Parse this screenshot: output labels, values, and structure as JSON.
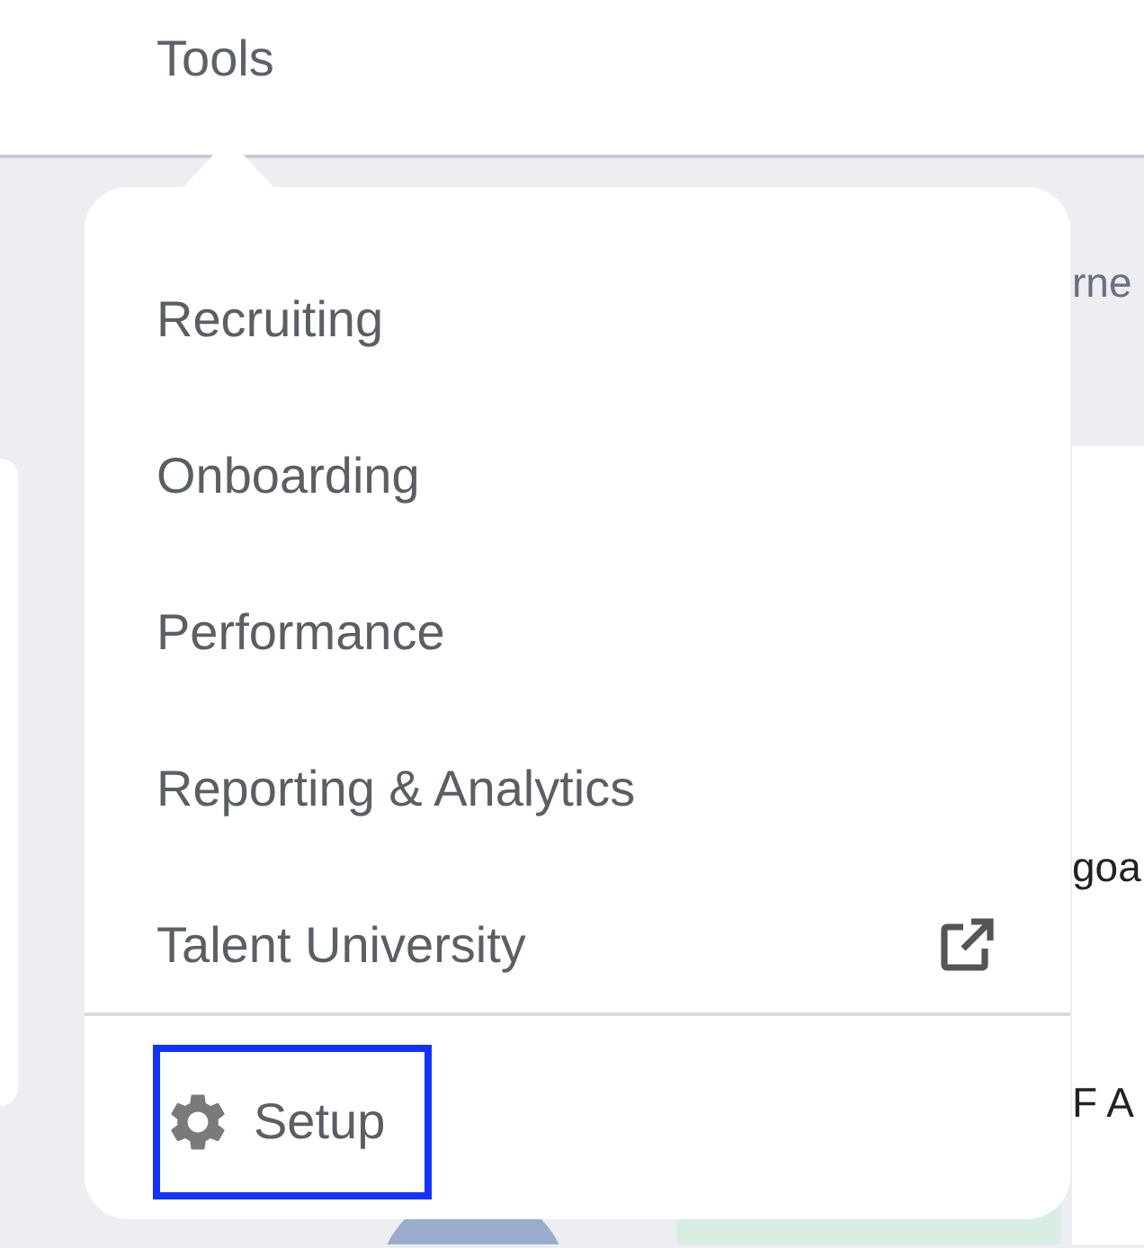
{
  "header": {
    "tab": "Tools"
  },
  "menu": {
    "items": [
      {
        "label": "Recruiting",
        "external": false
      },
      {
        "label": "Onboarding",
        "external": false
      },
      {
        "label": "Performance",
        "external": false
      },
      {
        "label": "Reporting & Analytics",
        "external": false
      },
      {
        "label": "Talent University",
        "external": true
      }
    ],
    "footer": {
      "label": "Setup",
      "focused": true
    }
  },
  "background": {
    "fragments": [
      "rne",
      "goa",
      "F A"
    ]
  }
}
